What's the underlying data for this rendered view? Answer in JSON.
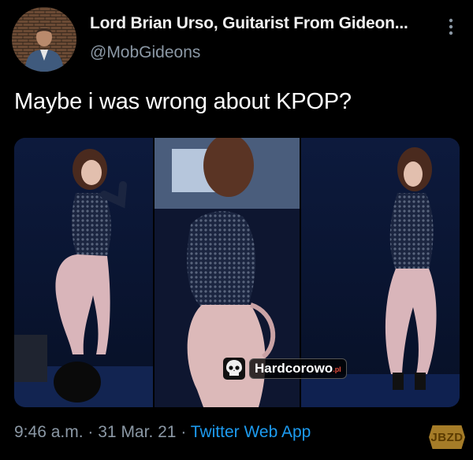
{
  "tweet": {
    "author_name": "Lord Brian Urso, Guitarist From Gideon...",
    "author_handle": "@MobGideons",
    "text": "Maybe i was wrong about KPOP?",
    "time": "9:46 a.m.",
    "date": "31 Mar. 21",
    "separator": "·",
    "source": "Twitter Web App"
  },
  "icons": {
    "more": "more-vertical-icon",
    "avatar": "avatar-photo",
    "skull": "skull-icon"
  },
  "watermark": {
    "brand": "Hardcorowo",
    "suffix": ".pl"
  },
  "corner_badge": {
    "text": "JBZD"
  },
  "colors": {
    "background": "#000000",
    "primary_text": "#ffffff",
    "secondary_text": "#8b98a5",
    "link": "#1d9bf0"
  }
}
